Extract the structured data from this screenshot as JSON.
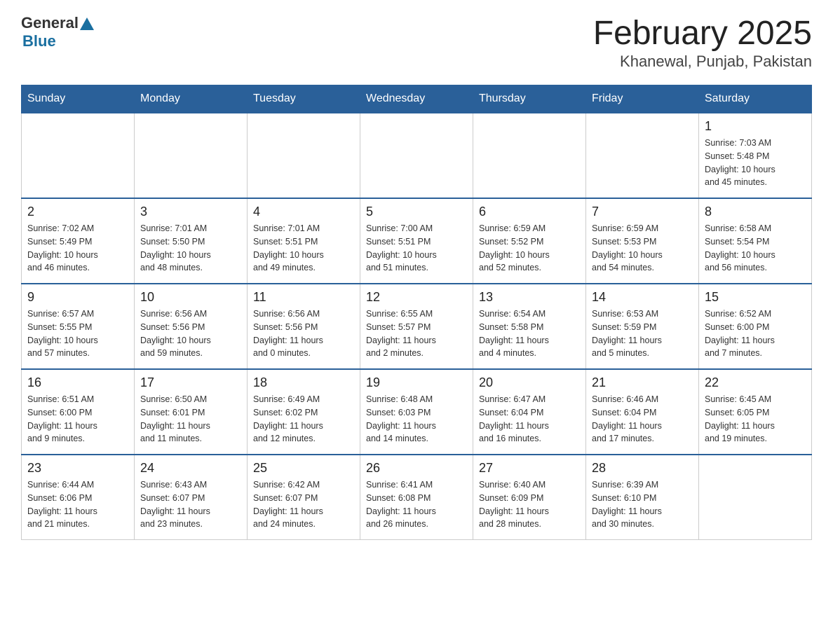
{
  "header": {
    "logo_general": "General",
    "logo_blue": "Blue",
    "title": "February 2025",
    "subtitle": "Khanewal, Punjab, Pakistan"
  },
  "days_of_week": [
    "Sunday",
    "Monday",
    "Tuesday",
    "Wednesday",
    "Thursday",
    "Friday",
    "Saturday"
  ],
  "weeks": [
    [
      {
        "day": "",
        "info": ""
      },
      {
        "day": "",
        "info": ""
      },
      {
        "day": "",
        "info": ""
      },
      {
        "day": "",
        "info": ""
      },
      {
        "day": "",
        "info": ""
      },
      {
        "day": "",
        "info": ""
      },
      {
        "day": "1",
        "info": "Sunrise: 7:03 AM\nSunset: 5:48 PM\nDaylight: 10 hours\nand 45 minutes."
      }
    ],
    [
      {
        "day": "2",
        "info": "Sunrise: 7:02 AM\nSunset: 5:49 PM\nDaylight: 10 hours\nand 46 minutes."
      },
      {
        "day": "3",
        "info": "Sunrise: 7:01 AM\nSunset: 5:50 PM\nDaylight: 10 hours\nand 48 minutes."
      },
      {
        "day": "4",
        "info": "Sunrise: 7:01 AM\nSunset: 5:51 PM\nDaylight: 10 hours\nand 49 minutes."
      },
      {
        "day": "5",
        "info": "Sunrise: 7:00 AM\nSunset: 5:51 PM\nDaylight: 10 hours\nand 51 minutes."
      },
      {
        "day": "6",
        "info": "Sunrise: 6:59 AM\nSunset: 5:52 PM\nDaylight: 10 hours\nand 52 minutes."
      },
      {
        "day": "7",
        "info": "Sunrise: 6:59 AM\nSunset: 5:53 PM\nDaylight: 10 hours\nand 54 minutes."
      },
      {
        "day": "8",
        "info": "Sunrise: 6:58 AM\nSunset: 5:54 PM\nDaylight: 10 hours\nand 56 minutes."
      }
    ],
    [
      {
        "day": "9",
        "info": "Sunrise: 6:57 AM\nSunset: 5:55 PM\nDaylight: 10 hours\nand 57 minutes."
      },
      {
        "day": "10",
        "info": "Sunrise: 6:56 AM\nSunset: 5:56 PM\nDaylight: 10 hours\nand 59 minutes."
      },
      {
        "day": "11",
        "info": "Sunrise: 6:56 AM\nSunset: 5:56 PM\nDaylight: 11 hours\nand 0 minutes."
      },
      {
        "day": "12",
        "info": "Sunrise: 6:55 AM\nSunset: 5:57 PM\nDaylight: 11 hours\nand 2 minutes."
      },
      {
        "day": "13",
        "info": "Sunrise: 6:54 AM\nSunset: 5:58 PM\nDaylight: 11 hours\nand 4 minutes."
      },
      {
        "day": "14",
        "info": "Sunrise: 6:53 AM\nSunset: 5:59 PM\nDaylight: 11 hours\nand 5 minutes."
      },
      {
        "day": "15",
        "info": "Sunrise: 6:52 AM\nSunset: 6:00 PM\nDaylight: 11 hours\nand 7 minutes."
      }
    ],
    [
      {
        "day": "16",
        "info": "Sunrise: 6:51 AM\nSunset: 6:00 PM\nDaylight: 11 hours\nand 9 minutes."
      },
      {
        "day": "17",
        "info": "Sunrise: 6:50 AM\nSunset: 6:01 PM\nDaylight: 11 hours\nand 11 minutes."
      },
      {
        "day": "18",
        "info": "Sunrise: 6:49 AM\nSunset: 6:02 PM\nDaylight: 11 hours\nand 12 minutes."
      },
      {
        "day": "19",
        "info": "Sunrise: 6:48 AM\nSunset: 6:03 PM\nDaylight: 11 hours\nand 14 minutes."
      },
      {
        "day": "20",
        "info": "Sunrise: 6:47 AM\nSunset: 6:04 PM\nDaylight: 11 hours\nand 16 minutes."
      },
      {
        "day": "21",
        "info": "Sunrise: 6:46 AM\nSunset: 6:04 PM\nDaylight: 11 hours\nand 17 minutes."
      },
      {
        "day": "22",
        "info": "Sunrise: 6:45 AM\nSunset: 6:05 PM\nDaylight: 11 hours\nand 19 minutes."
      }
    ],
    [
      {
        "day": "23",
        "info": "Sunrise: 6:44 AM\nSunset: 6:06 PM\nDaylight: 11 hours\nand 21 minutes."
      },
      {
        "day": "24",
        "info": "Sunrise: 6:43 AM\nSunset: 6:07 PM\nDaylight: 11 hours\nand 23 minutes."
      },
      {
        "day": "25",
        "info": "Sunrise: 6:42 AM\nSunset: 6:07 PM\nDaylight: 11 hours\nand 24 minutes."
      },
      {
        "day": "26",
        "info": "Sunrise: 6:41 AM\nSunset: 6:08 PM\nDaylight: 11 hours\nand 26 minutes."
      },
      {
        "day": "27",
        "info": "Sunrise: 6:40 AM\nSunset: 6:09 PM\nDaylight: 11 hours\nand 28 minutes."
      },
      {
        "day": "28",
        "info": "Sunrise: 6:39 AM\nSunset: 6:10 PM\nDaylight: 11 hours\nand 30 minutes."
      },
      {
        "day": "",
        "info": ""
      }
    ]
  ]
}
